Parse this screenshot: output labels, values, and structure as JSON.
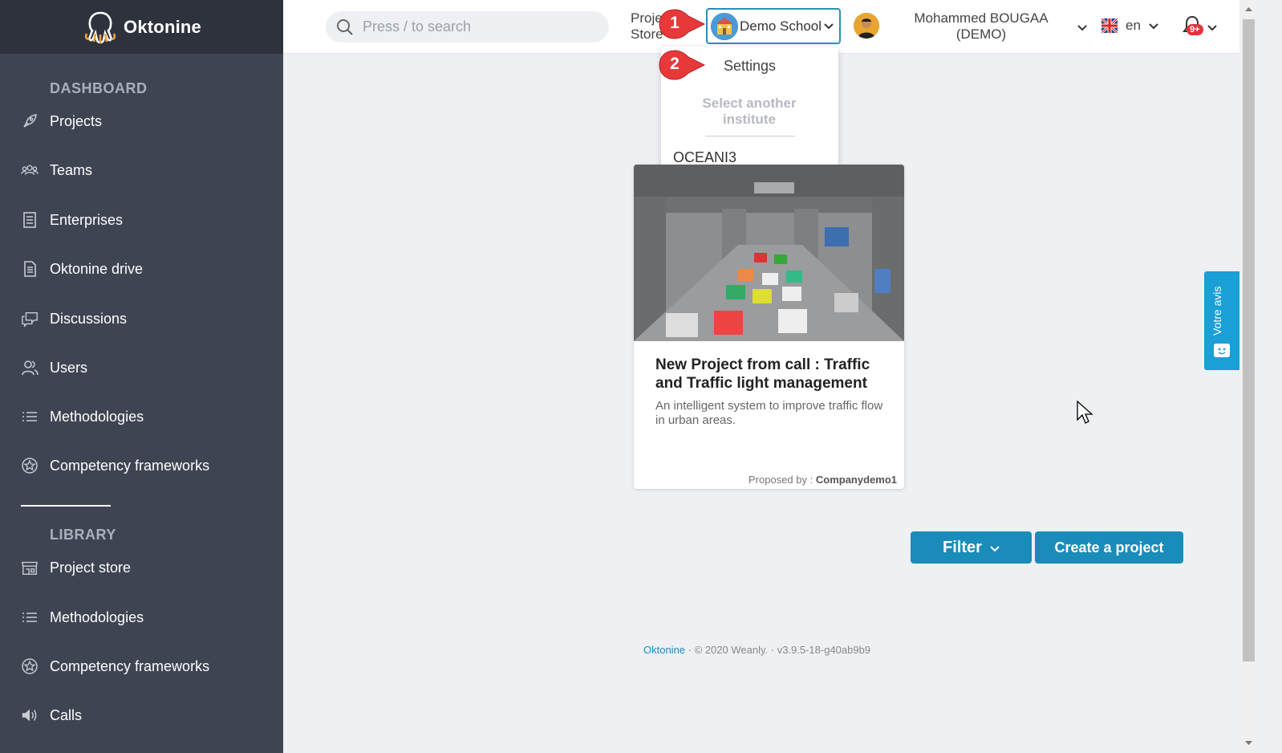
{
  "app": {
    "name": "Oktonine"
  },
  "sidebar": {
    "dashboard_title": "DASHBOARD",
    "dashboard_items": [
      {
        "label": "Projects",
        "icon": "rocket-icon"
      },
      {
        "label": "Teams",
        "icon": "team-icon"
      },
      {
        "label": "Enterprises",
        "icon": "enterprise-icon"
      },
      {
        "label": "Oktonine drive",
        "icon": "drive-icon"
      },
      {
        "label": "Discussions",
        "icon": "discussion-icon"
      },
      {
        "label": "Users",
        "icon": "users-icon"
      },
      {
        "label": "Methodologies",
        "icon": "list-icon"
      },
      {
        "label": "Competency frameworks",
        "icon": "badge-icon"
      }
    ],
    "library_title": "LIBRARY",
    "library_items": [
      {
        "label": "Project store",
        "icon": "store-icon"
      },
      {
        "label": "Methodologies",
        "icon": "list-icon"
      },
      {
        "label": "Competency frameworks",
        "icon": "badge-icon"
      },
      {
        "label": "Calls",
        "icon": "speaker-icon"
      }
    ]
  },
  "header": {
    "search_placeholder": "Press / to search",
    "project_store_label": "Project Store",
    "institute_name": "Demo School",
    "user_name": "Mohammed BOUGAA (DEMO)",
    "language": "en",
    "notification_badge": "9+"
  },
  "dropdown": {
    "settings_label": "Settings",
    "select_another_label": "Select another institute",
    "institutes": [
      "OCEANI3"
    ]
  },
  "markers": [
    "1",
    "2"
  ],
  "card": {
    "title": "New Project from call : Traffic and Traffic light management",
    "description": "An intelligent system to improve traffic flow in urban areas.",
    "proposed_by_label": "Proposed by :",
    "proposed_by": "Companydemo1"
  },
  "actions": {
    "filter_label": "Filter",
    "create_label": "Create a project"
  },
  "footer": {
    "brand": "Oktonine",
    "copyright": "© 2020 Weanly.",
    "version": "v3.9.5-18-g40ab9b9"
  },
  "feedback": {
    "label": "Votre avis"
  },
  "colors": {
    "sidebar_bg": "#3e4452",
    "logo_bar_bg": "#2d323d",
    "accent": "#1a8cba",
    "marker_red": "#e8393a",
    "feedback_bg": "#1a9fd6"
  }
}
